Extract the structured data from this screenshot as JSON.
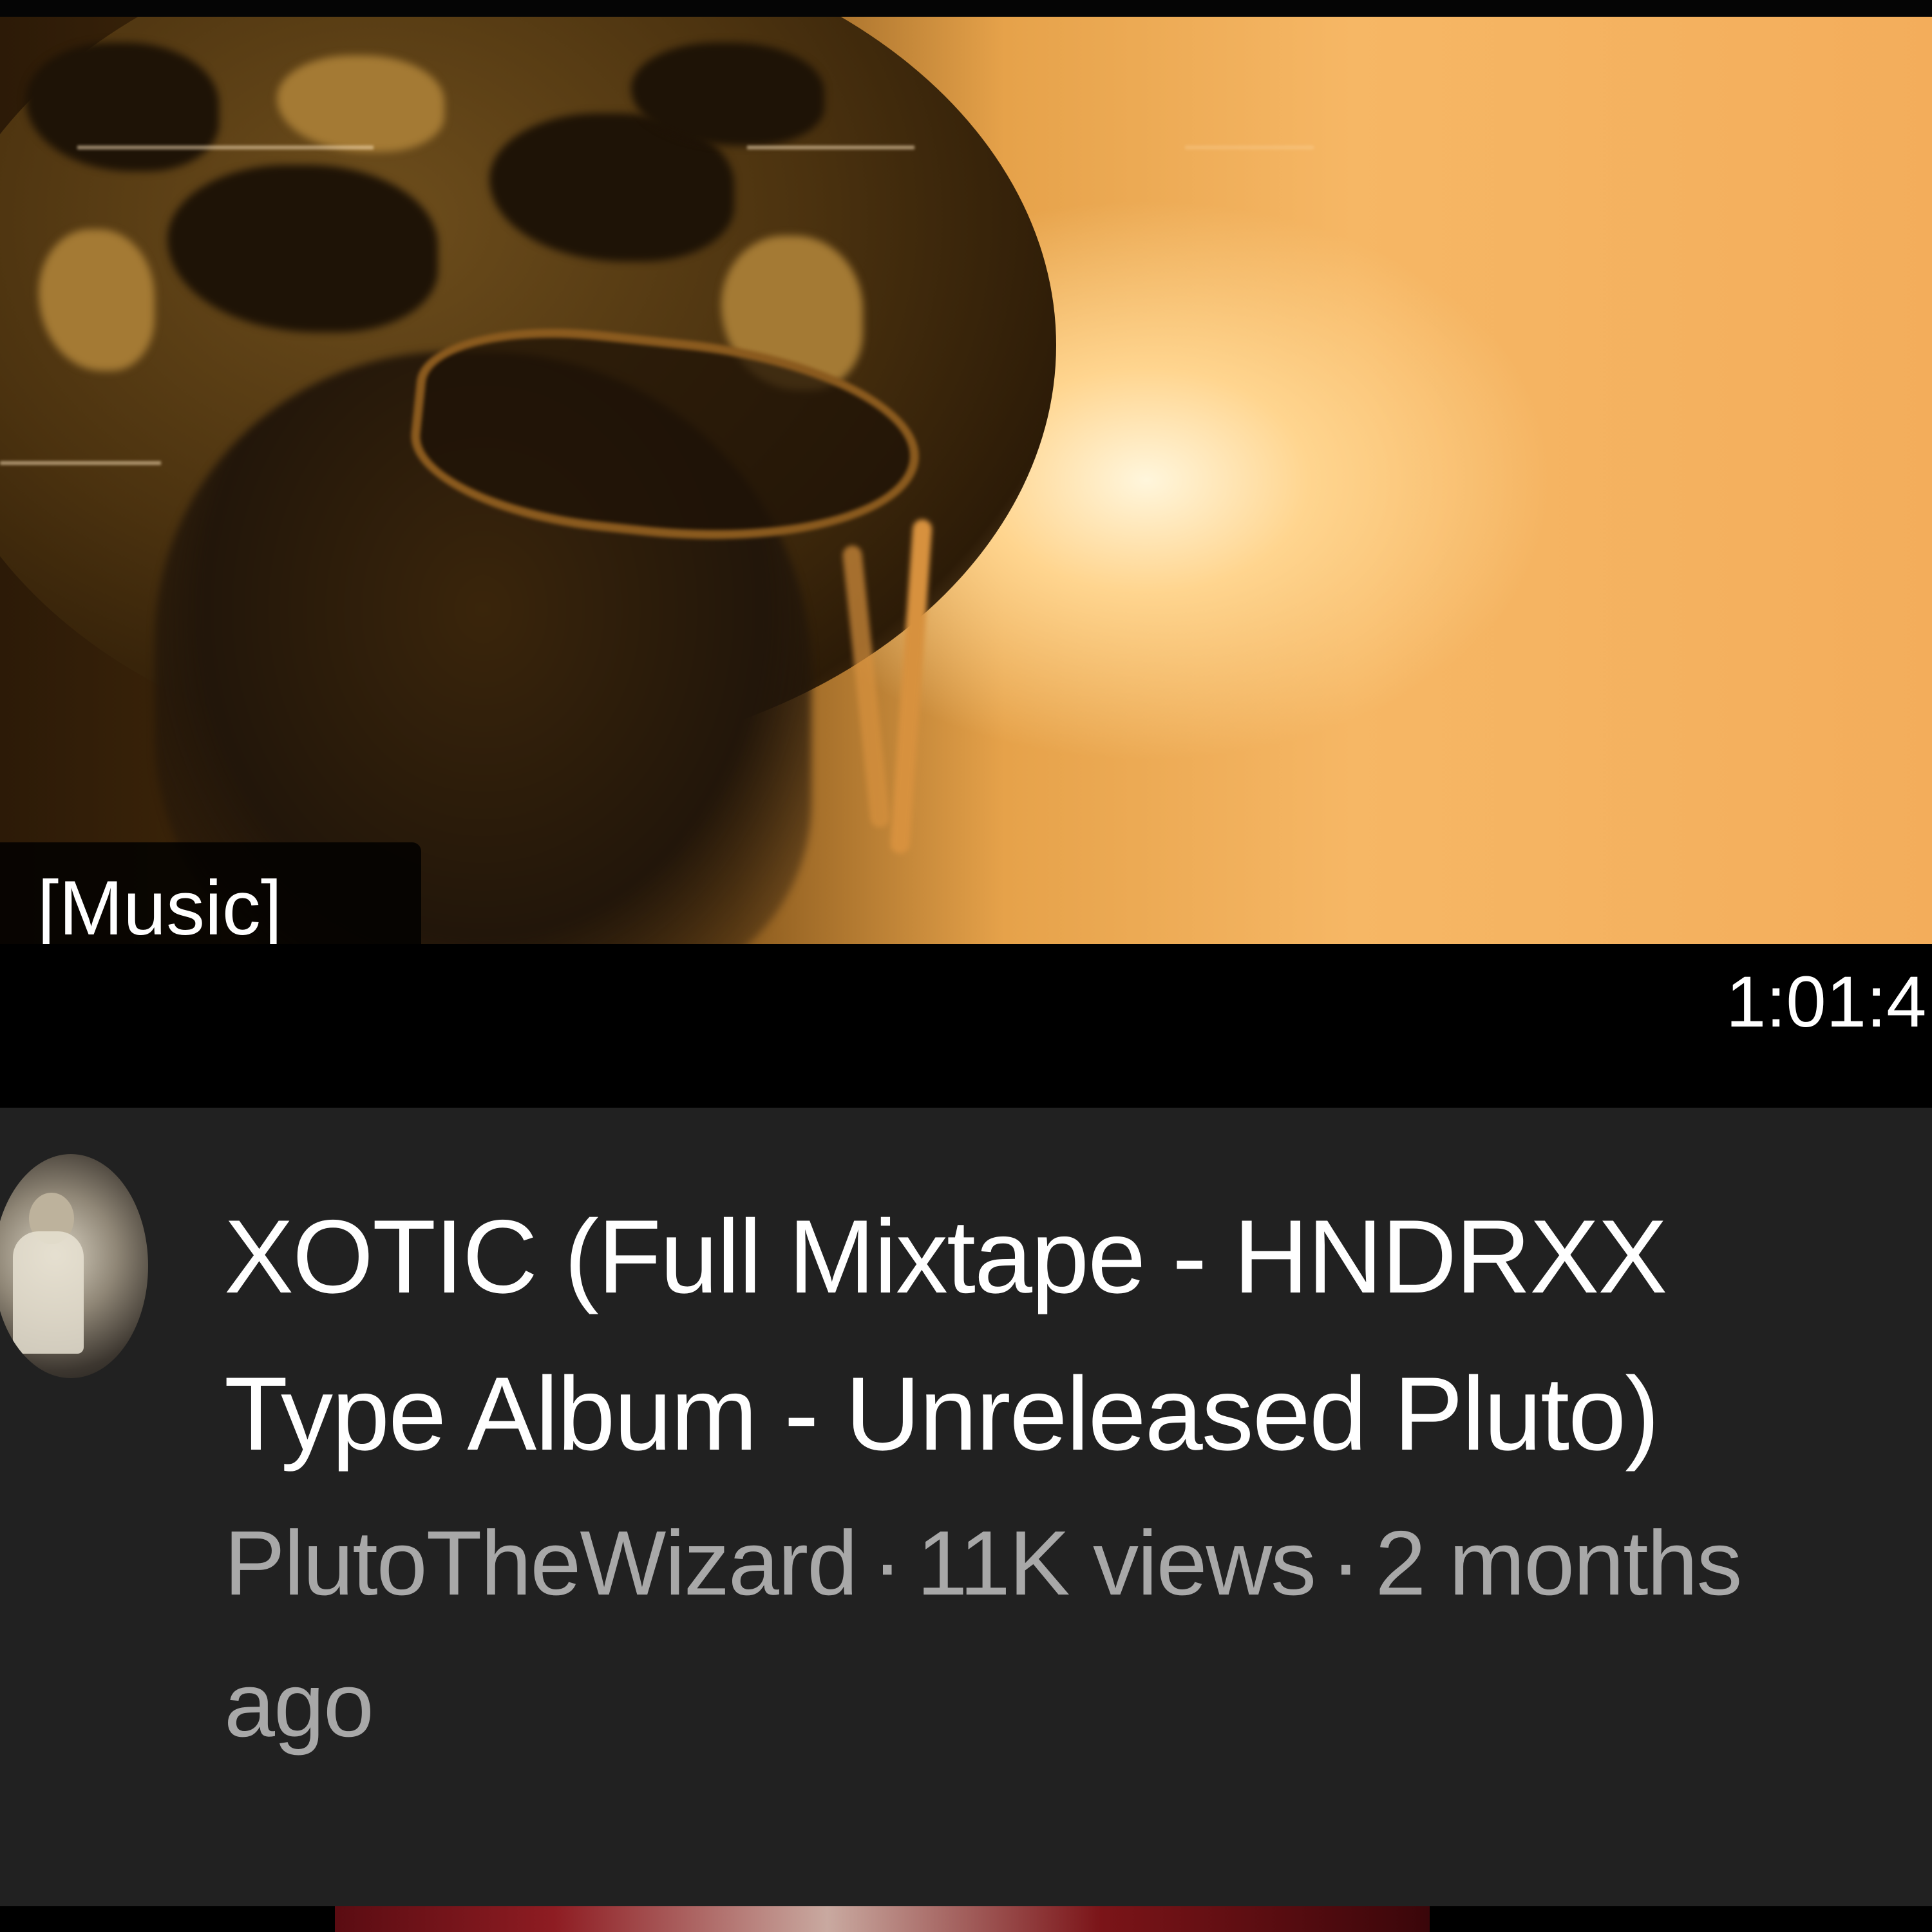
{
  "video": {
    "caption": "[Music]",
    "duration": "1:01:4"
  },
  "card": {
    "avatar_icon": "channel-avatar",
    "title": "XOTIC (Full Mixtape - HNDRXX Type Album - Unreleased Pluto)",
    "channel": "PlutoTheWizard",
    "separator": "·",
    "views": "11K views",
    "age": "2 months ago"
  },
  "colors": {
    "card_background": "#212121",
    "title_text": "#ffffff",
    "meta_text": "#a8a8a8"
  }
}
